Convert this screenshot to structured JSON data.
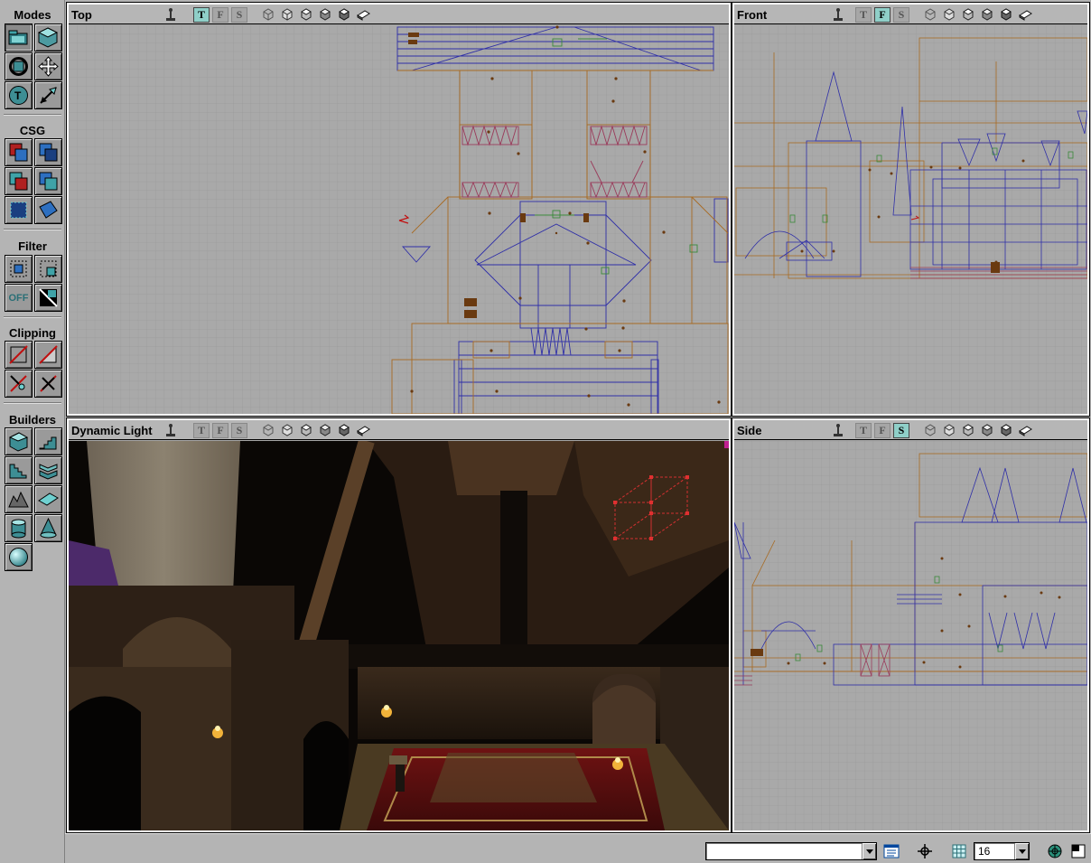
{
  "toolbar": {
    "sections": [
      {
        "id": "modes",
        "label": "Modes"
      },
      {
        "id": "csg",
        "label": "CSG"
      },
      {
        "id": "filter",
        "label": "Filter"
      },
      {
        "id": "clipping",
        "label": "Clipping"
      },
      {
        "id": "builders",
        "label": "Builders"
      }
    ],
    "filter_off_label": "OFF"
  },
  "viewports": {
    "top": {
      "title": "Top",
      "axis_buttons": [
        "T",
        "F",
        "S"
      ],
      "active_axis": "T"
    },
    "front": {
      "title": "Front",
      "axis_buttons": [
        "T",
        "F",
        "S"
      ],
      "active_axis": "F"
    },
    "side": {
      "title": "Side",
      "axis_buttons": [
        "T",
        "F",
        "S"
      ],
      "active_axis": "S"
    },
    "perspective": {
      "title": "Dynamic Light",
      "axis_buttons": [
        "T",
        "F",
        "S"
      ],
      "active_axis": ""
    }
  },
  "view_mode_icons": [
    "wireframe-cube-icon",
    "zone-cube-icon",
    "texture-cube-icon",
    "flat-shaded-cube-icon",
    "dynamic-light-cube-icon",
    "textured-book-icon"
  ],
  "statusbar": {
    "command_value": "",
    "grid_size": "16"
  },
  "colors": {
    "panel_bg": "#b4b4b4",
    "grid_bg": "#a9a9a9",
    "brush_blue": "#2f2fa8",
    "brush_orange": "#a86a22",
    "active_axis_bg": "#8fcfc8"
  }
}
